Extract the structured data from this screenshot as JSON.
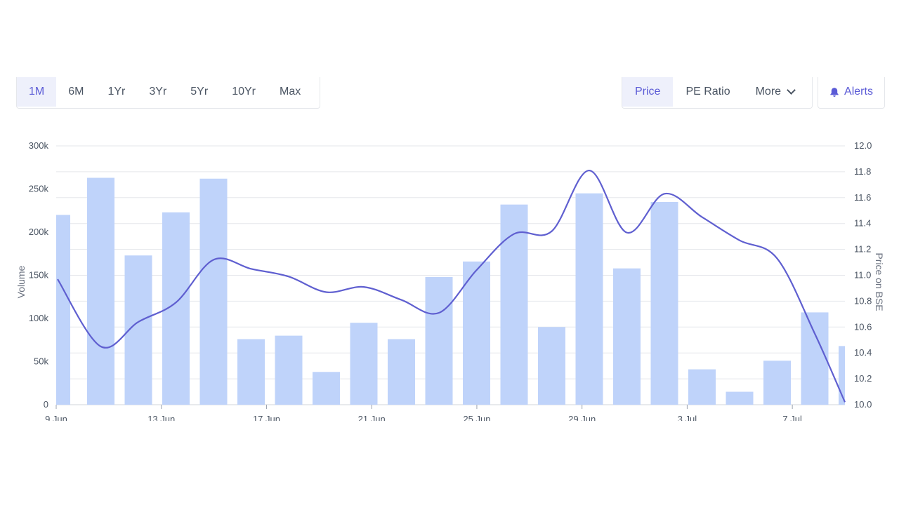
{
  "toolbar": {
    "ranges": [
      "1M",
      "6M",
      "1Yr",
      "3Yr",
      "5Yr",
      "10Yr",
      "Max"
    ],
    "active_range": "1M",
    "metrics": [
      "Price",
      "PE Ratio"
    ],
    "active_metric": "Price",
    "more_label": "More",
    "alerts_label": "Alerts"
  },
  "colors": {
    "accent": "#5b5bd6",
    "bar": "#bfd3fa",
    "line": "#5f5fd0",
    "grid": "#e5e7eb"
  },
  "chart_data": {
    "type": "bar",
    "title": "",
    "xlabel": "",
    "ylabel": "Volume",
    "y2label": "Price on BSE",
    "ylim": [
      0,
      300000
    ],
    "y2lim": [
      10.0,
      12.0
    ],
    "ytick_labels": [
      "0",
      "50k",
      "100k",
      "150k",
      "200k",
      "250k",
      "300k"
    ],
    "y2tick_labels": [
      "10.0",
      "10.2",
      "10.4",
      "10.6",
      "10.8",
      "11.0",
      "11.2",
      "11.4",
      "11.6",
      "11.8",
      "12.0"
    ],
    "xtick_labels": [
      {
        "label": "9 Jun",
        "date": "2023-06-09"
      },
      {
        "label": "13 Jun",
        "date": "2023-06-13"
      },
      {
        "label": "17 Jun",
        "date": "2023-06-17"
      },
      {
        "label": "21 Jun",
        "date": "2023-06-21"
      },
      {
        "label": "25 Jun",
        "date": "2023-06-25"
      },
      {
        "label": "29 Jun",
        "date": "2023-06-29"
      },
      {
        "label": "3 Jul",
        "date": "2023-07-03"
      },
      {
        "label": "7 Jul",
        "date": "2023-07-07"
      }
    ],
    "x_range": [
      "2023-06-09",
      "2023-07-09"
    ],
    "grid": true,
    "series": [
      {
        "name": "Volume",
        "type": "bar",
        "points": [
          {
            "x": "2023-06-09",
            "y": 220000
          },
          {
            "x": "2023-06-10",
            "y": 263000
          },
          {
            "x": "2023-06-11",
            "y": 173000
          },
          {
            "x": "2023-06-12",
            "y": 223000
          },
          {
            "x": "2023-06-13",
            "y": 262000
          },
          {
            "x": "2023-06-14",
            "y": 76000
          },
          {
            "x": "2023-06-15",
            "y": 80000
          },
          {
            "x": "2023-06-16",
            "y": 38000
          },
          {
            "x": "2023-06-17",
            "y": 95000
          },
          {
            "x": "2023-06-18",
            "y": 76000
          },
          {
            "x": "2023-06-19",
            "y": 148000
          },
          {
            "x": "2023-06-20",
            "y": 166000
          },
          {
            "x": "2023-06-21",
            "y": 232000
          },
          {
            "x": "2023-06-22",
            "y": 90000
          },
          {
            "x": "2023-06-23",
            "y": 245000
          },
          {
            "x": "2023-06-24",
            "y": 158000
          },
          {
            "x": "2023-06-25",
            "y": 235000
          },
          {
            "x": "2023-06-26",
            "y": 41000
          },
          {
            "x": "2023-06-27",
            "y": 15000
          },
          {
            "x": "2023-06-28",
            "y": 51000
          },
          {
            "x": "2023-06-29",
            "y": 107000
          },
          {
            "x": "2023-06-30",
            "y": 68000
          }
        ]
      },
      {
        "name": "Price on BSE",
        "type": "line",
        "points": [
          {
            "x": "2023-06-09",
            "y": 10.97
          },
          {
            "x": "2023-06-10",
            "y": 10.45
          },
          {
            "x": "2023-06-11",
            "y": 10.64
          },
          {
            "x": "2023-06-12",
            "y": 10.79
          },
          {
            "x": "2023-06-13",
            "y": 11.12
          },
          {
            "x": "2023-06-14",
            "y": 11.05
          },
          {
            "x": "2023-06-15",
            "y": 10.99
          },
          {
            "x": "2023-06-16",
            "y": 10.87
          },
          {
            "x": "2023-06-17",
            "y": 10.91
          },
          {
            "x": "2023-06-18",
            "y": 10.81
          },
          {
            "x": "2023-06-19",
            "y": 10.71
          },
          {
            "x": "2023-06-20",
            "y": 11.04
          },
          {
            "x": "2023-06-21",
            "y": 11.32
          },
          {
            "x": "2023-06-22",
            "y": 11.34
          },
          {
            "x": "2023-06-23",
            "y": 11.81
          },
          {
            "x": "2023-06-24",
            "y": 11.33
          },
          {
            "x": "2023-06-25",
            "y": 11.63
          },
          {
            "x": "2023-06-26",
            "y": 11.45
          },
          {
            "x": "2023-06-27",
            "y": 11.27
          },
          {
            "x": "2023-06-28",
            "y": 11.13
          },
          {
            "x": "2023-06-29",
            "y": 10.55
          },
          {
            "x": "2023-06-30",
            "y": 10.02
          }
        ]
      }
    ]
  }
}
